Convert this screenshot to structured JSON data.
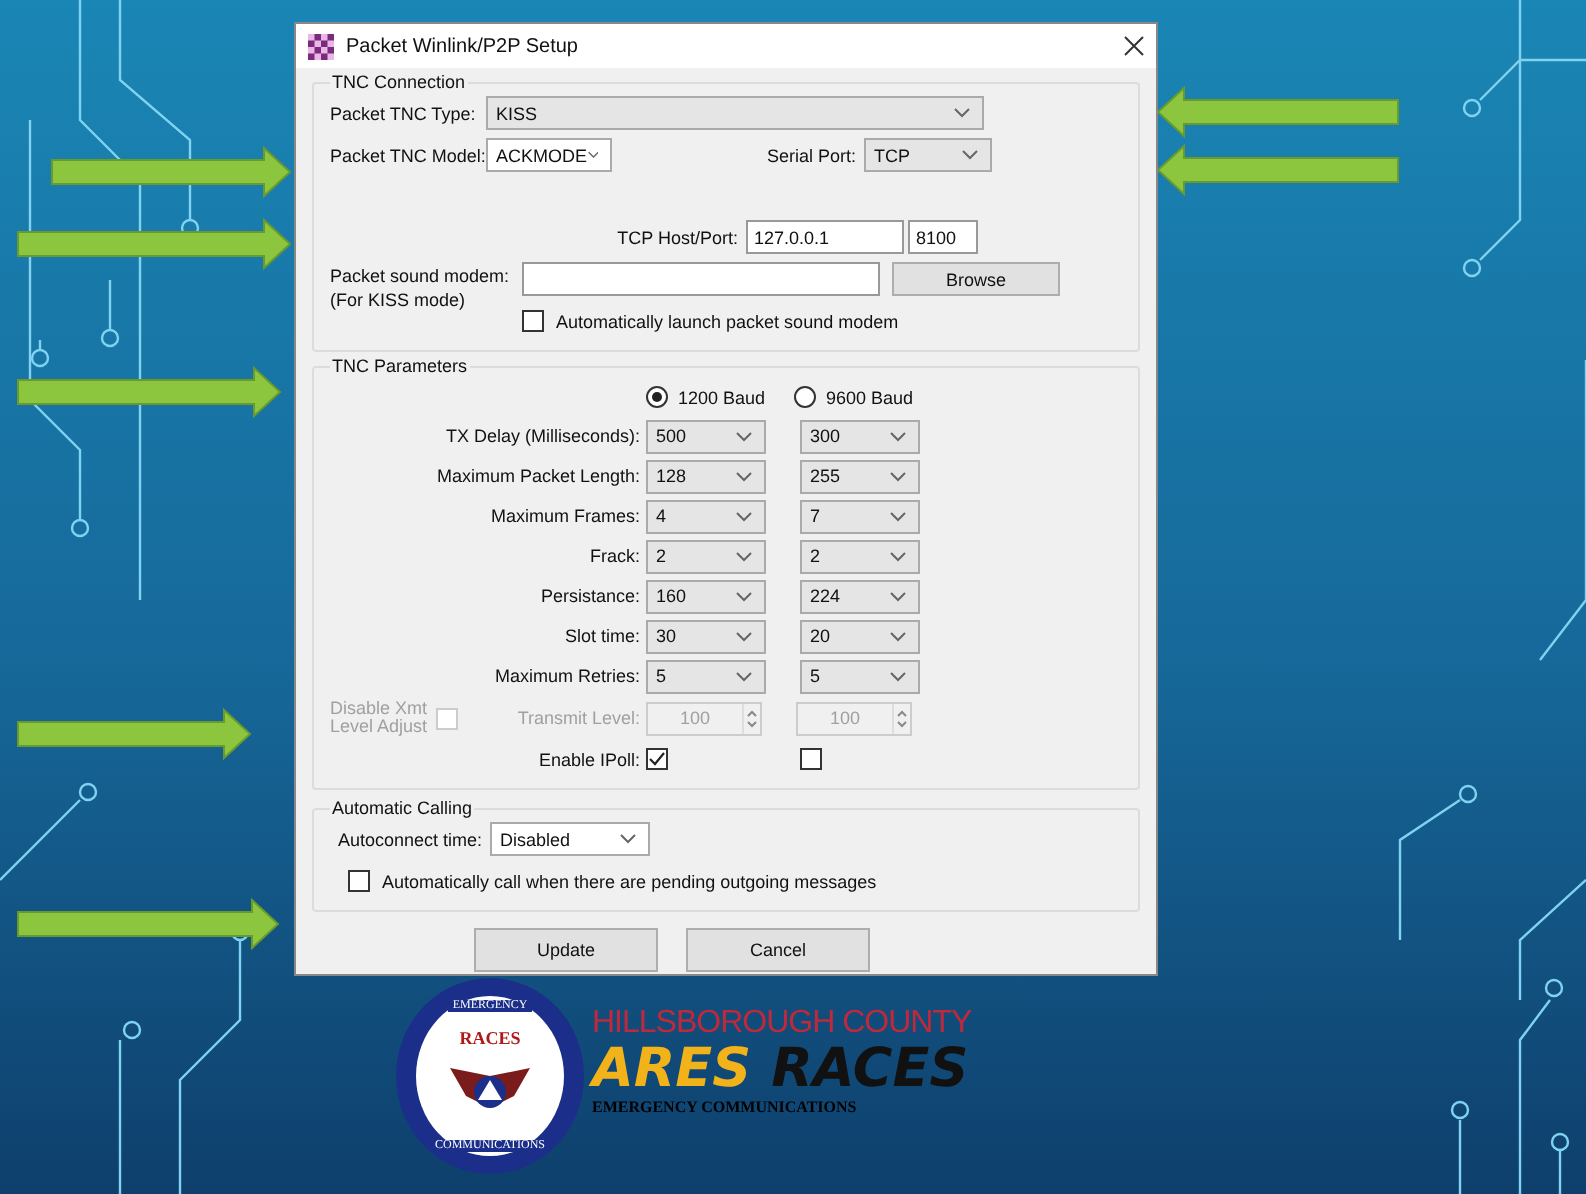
{
  "window": {
    "title": "Packet Winlink/P2P Setup"
  },
  "tnc_connection": {
    "title": "TNC Connection",
    "tnc_type": {
      "label": "Packet TNC Type:",
      "value": "KISS"
    },
    "tnc_model": {
      "label": "Packet TNC Model:",
      "value": "ACKMODE"
    },
    "serial_port": {
      "label": "Serial Port:",
      "value": "TCP"
    },
    "tcp": {
      "label": "TCP Host/Port:",
      "host": "127.0.0.1",
      "port": "8100"
    },
    "sound_modem": {
      "label": "Packet sound modem:",
      "sublabel": "(For KISS mode)",
      "button": "Browse"
    },
    "auto_launch": {
      "label": "Automatically launch packet sound modem",
      "checked": false
    }
  },
  "tnc_parameters": {
    "title": "TNC Parameters",
    "bauds": [
      {
        "label": "1200 Baud",
        "selected": true
      },
      {
        "label": "9600 Baud",
        "selected": false
      }
    ],
    "rows": [
      {
        "label": "TX Delay (Milliseconds):",
        "values": [
          "500",
          "300"
        ]
      },
      {
        "label": "Maximum Packet Length:",
        "values": [
          "128",
          "255"
        ]
      },
      {
        "label": "Maximum Frames:",
        "values": [
          "4",
          "7"
        ]
      },
      {
        "label": "Frack:",
        "values": [
          "2",
          "2"
        ]
      },
      {
        "label": "Persistance:",
        "values": [
          "160",
          "224"
        ]
      },
      {
        "label": "Slot time:",
        "values": [
          "30",
          "20"
        ]
      },
      {
        "label": "Maximum Retries:",
        "values": [
          "5",
          "5"
        ]
      }
    ],
    "disable_xmt": {
      "label": "Disable Xmt Level Adjust",
      "checked": false,
      "disabled": true
    },
    "transmit_level": {
      "label": "Transmit Level:",
      "values": [
        "100",
        "100"
      ],
      "disabled": true
    },
    "enable_ipoll": {
      "label": "Enable IPoll:",
      "boxes": [
        {
          "checked": true
        },
        {
          "checked": false
        }
      ]
    }
  },
  "automatic_calling": {
    "title": "Automatic Calling",
    "autoconnect": {
      "label": "Autoconnect time:",
      "value": "Disabled"
    },
    "auto_call": {
      "label": "Automatically call when there are pending outgoing messages",
      "checked": false
    }
  },
  "buttons": [
    "Update",
    "Cancel"
  ],
  "logo": {
    "seal_top": "EMERGENCY",
    "seal_center": "RACES",
    "seal_bottom": "COMMUNICATIONS",
    "county": "HILLSBOROUGH COUNTY",
    "ares": "ARES",
    "races": "RACES",
    "tagline": "EMERGENCY COMMUNICATIONS"
  }
}
